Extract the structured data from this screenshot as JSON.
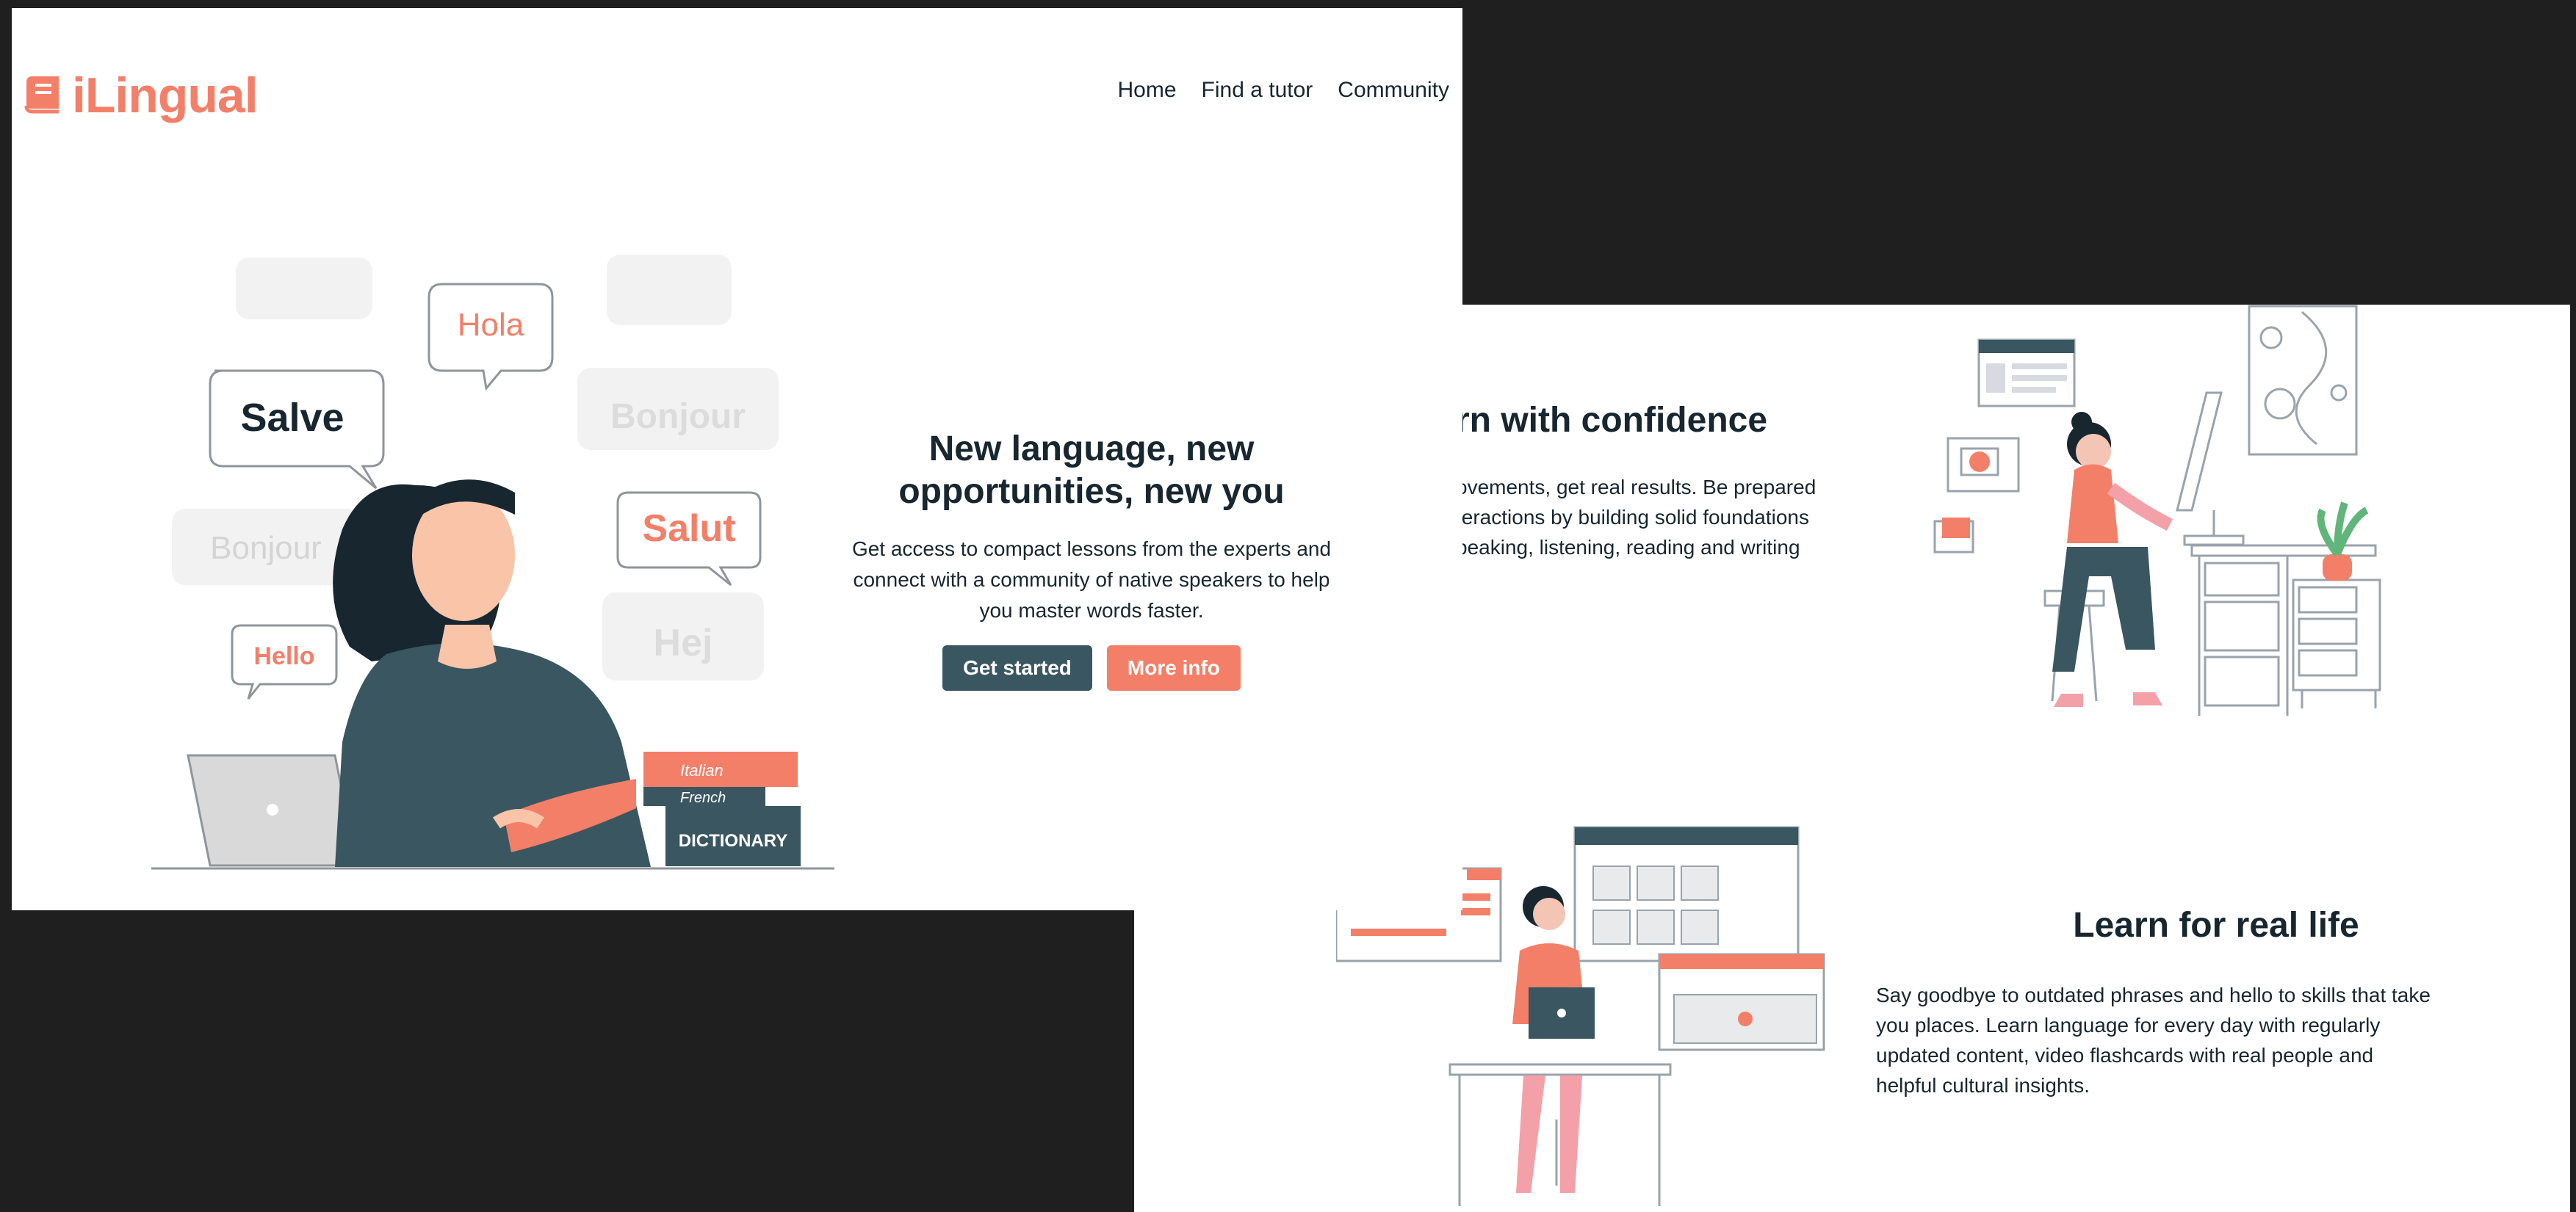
{
  "brand": {
    "name": "iLingual",
    "accent": "#f37f69",
    "dark": "#17262f",
    "button_dark": "#3a5660"
  },
  "nav": {
    "items": [
      {
        "label": "Home"
      },
      {
        "label": "Find a tutor"
      },
      {
        "label": "Community"
      }
    ]
  },
  "hero": {
    "title": "New language, new opportunities, new you",
    "description": "Get access to compact lessons from the experts and connect with a community of native speakers to help you master words faster.",
    "primary_button": "Get started",
    "secondary_button": "More info",
    "illustration": {
      "bubbles": [
        "Hola",
        "Salve",
        "Bonjour",
        "Salut",
        "Bonjour",
        "Hello",
        "Hej"
      ],
      "books": [
        "Italian",
        "French",
        "DICTIONARY"
      ]
    }
  },
  "features": [
    {
      "title": "rn with confidence",
      "description": "ovements, get real results. Be prepared teractions by building solid foundations peaking, listening, reading and writing"
    },
    {
      "title": "Learn for real life",
      "description": "Say goodbye to outdated phrases and hello to skills that take you places. Learn language for every day with regularly updated content, video flashcards with real people and helpful cultural insights."
    }
  ]
}
